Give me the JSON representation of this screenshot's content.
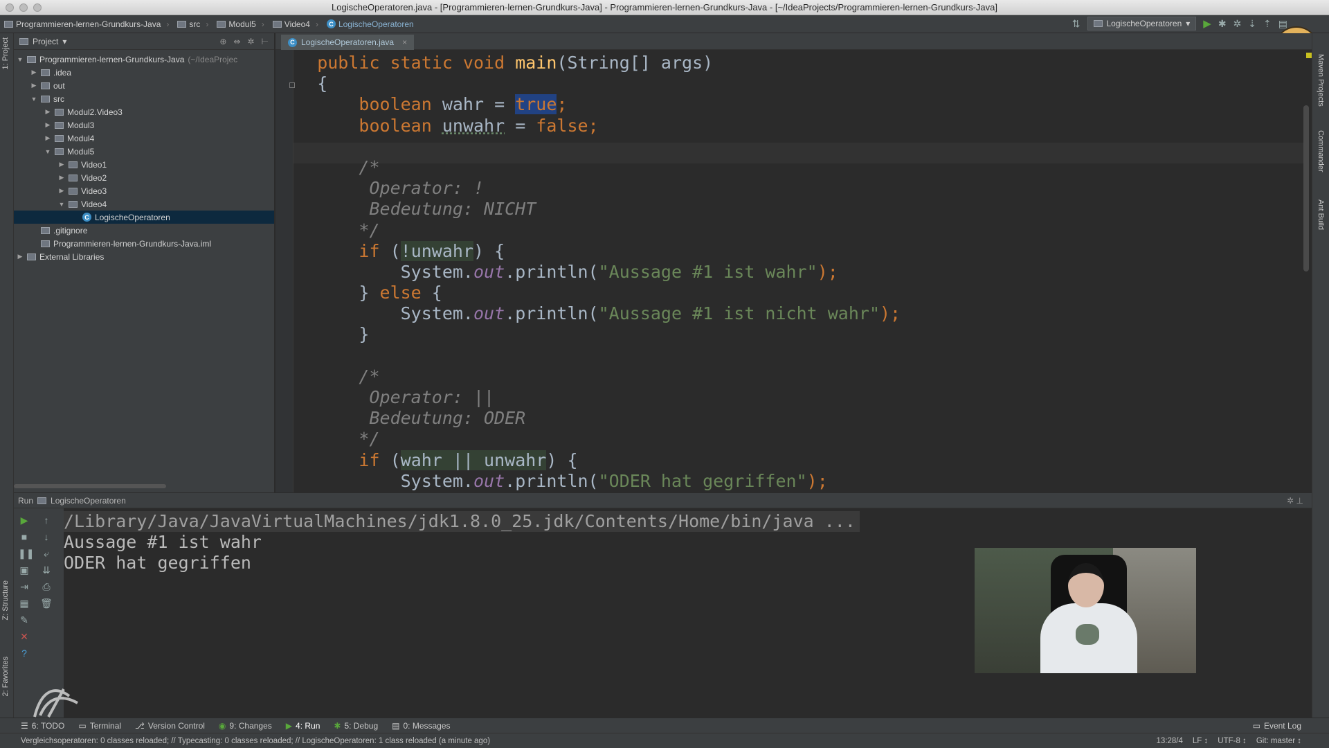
{
  "window": {
    "title": "LogischeOperatoren.java - [Programmieren-lernen-Grundkurs-Java] - Programmieren-lernen-Grundkurs-Java - [~/IdeaProjects/Programmieren-lernen-Grundkurs-Java]"
  },
  "breadcrumbs": [
    "Programmieren-lernen-Grundkurs-Java",
    "src",
    "Modul5",
    "Video4",
    "LogischeOperatoren"
  ],
  "toolbar": {
    "run_config": "LogischeOperatoren"
  },
  "left_strip": {
    "project_tab": "1: Project",
    "structure_tab": "Z: Structure",
    "favorites_tab": "2: Favorites"
  },
  "right_strip": {
    "maven": "Maven Projects",
    "commander": "Commander",
    "ant": "Ant Build"
  },
  "project_panel": {
    "header": "Project",
    "tree": [
      {
        "label": "Programmieren-lernen-Grundkurs-Java",
        "hint": "(~/IdeaProjec",
        "depth": 0,
        "expanded": true,
        "icon": "module-icon"
      },
      {
        "label": ".idea",
        "depth": 1,
        "expanded": false,
        "icon": "folder-icon"
      },
      {
        "label": "out",
        "depth": 1,
        "expanded": false,
        "icon": "folder-icon"
      },
      {
        "label": "src",
        "depth": 1,
        "expanded": true,
        "icon": "folder-icon"
      },
      {
        "label": "Modul2.Video3",
        "depth": 2,
        "expanded": false,
        "icon": "package-icon"
      },
      {
        "label": "Modul3",
        "depth": 2,
        "expanded": false,
        "icon": "package-icon"
      },
      {
        "label": "Modul4",
        "depth": 2,
        "expanded": false,
        "icon": "package-icon"
      },
      {
        "label": "Modul5",
        "depth": 2,
        "expanded": true,
        "icon": "package-icon"
      },
      {
        "label": "Video1",
        "depth": 3,
        "expanded": false,
        "icon": "package-icon"
      },
      {
        "label": "Video2",
        "depth": 3,
        "expanded": false,
        "icon": "package-icon"
      },
      {
        "label": "Video3",
        "depth": 3,
        "expanded": false,
        "icon": "package-icon"
      },
      {
        "label": "Video4",
        "depth": 3,
        "expanded": true,
        "icon": "package-icon"
      },
      {
        "label": "LogischeOperatoren",
        "depth": 4,
        "selected": true,
        "icon": "java-class-icon"
      },
      {
        "label": ".gitignore",
        "depth": 1,
        "icon": "file-icon"
      },
      {
        "label": "Programmieren-lernen-Grundkurs-Java.iml",
        "depth": 1,
        "icon": "iml-file-icon"
      },
      {
        "label": "External Libraries",
        "depth": 0,
        "expanded": false,
        "icon": "library-icon"
      }
    ]
  },
  "editor": {
    "tab_label": "LogischeOperatoren.java",
    "code_lines": [
      [
        [
          "    public static void ",
          "kw"
        ],
        [
          "main",
          "fn"
        ],
        [
          "(String[] args)",
          ""
        ]
      ],
      [
        [
          "    {",
          ""
        ]
      ],
      [
        [
          "        boolean ",
          "kw"
        ],
        [
          "wahr",
          ""
        ],
        [
          " = ",
          ""
        ],
        [
          "true",
          "kw hlsel"
        ],
        [
          ";",
          "kw"
        ]
      ],
      [
        [
          "        boolean ",
          "kw"
        ],
        [
          "unwahr",
          "und"
        ],
        [
          " = ",
          ""
        ],
        [
          "false",
          "kw"
        ],
        [
          ";",
          "kw"
        ]
      ],
      [
        [
          "",
          ""
        ]
      ],
      [
        [
          "        /*",
          "cm"
        ]
      ],
      [
        [
          "         Operator: !",
          "cm"
        ]
      ],
      [
        [
          "         Bedeutung: NICHT",
          "cm"
        ]
      ],
      [
        [
          "        */",
          "cm"
        ]
      ],
      [
        [
          "        if ",
          "kw"
        ],
        [
          "(",
          ""
        ],
        [
          "!unwahr",
          "hl"
        ],
        [
          ") {",
          ""
        ]
      ],
      [
        [
          "            System.",
          ""
        ],
        [
          "out",
          "fld"
        ],
        [
          ".println(",
          ""
        ],
        [
          "\"Aussage #1 ist wahr\"",
          "st"
        ],
        [
          ");",
          "kw"
        ]
      ],
      [
        [
          "        } ",
          ""
        ],
        [
          "else",
          "kw"
        ],
        [
          " {",
          ""
        ]
      ],
      [
        [
          "            System.",
          ""
        ],
        [
          "out",
          "fld"
        ],
        [
          ".println(",
          ""
        ],
        [
          "\"Aussage #1 ist nicht wahr\"",
          "st"
        ],
        [
          ");",
          "kw"
        ]
      ],
      [
        [
          "        }",
          ""
        ]
      ],
      [
        [
          "",
          ""
        ]
      ],
      [
        [
          "        /*",
          "cm"
        ]
      ],
      [
        [
          "         Operator: ||",
          "cm"
        ]
      ],
      [
        [
          "         Bedeutung: ODER",
          "cm"
        ]
      ],
      [
        [
          "        */",
          "cm"
        ]
      ],
      [
        [
          "        if ",
          "kw"
        ],
        [
          "(",
          ""
        ],
        [
          "wahr || unwahr",
          "hl"
        ],
        [
          ") {",
          ""
        ]
      ],
      [
        [
          "            System.",
          ""
        ],
        [
          "out",
          "fld"
        ],
        [
          ".println(",
          ""
        ],
        [
          "\"ODER hat gegriffen\"",
          "st"
        ],
        [
          ");",
          "kw"
        ]
      ]
    ]
  },
  "run_panel": {
    "header_label": "Run",
    "config_name": "LogischeOperatoren",
    "output": [
      "/Library/Java/JavaVirtualMachines/jdk1.8.0_25.jdk/Contents/Home/bin/java ...",
      "Aussage #1 ist wahr",
      "ODER hat gegriffen"
    ]
  },
  "tool_windows": [
    {
      "label": "6: TODO",
      "icon": "todo-icon"
    },
    {
      "label": "Terminal",
      "icon": "terminal-icon"
    },
    {
      "label": "Version Control",
      "icon": "vcs-icon"
    },
    {
      "label": "9: Changes",
      "icon": "changes-icon"
    },
    {
      "label": "4: Run",
      "icon": "run-icon",
      "active": true
    },
    {
      "label": "5: Debug",
      "icon": "debug-icon"
    },
    {
      "label": "0: Messages",
      "icon": "messages-icon"
    }
  ],
  "event_log": "Event Log",
  "status": {
    "message": "Vergleichsoperatoren: 0 classes reloaded; // Typecasting: 0 classes reloaded; // LogischeOperatoren: 1 class reloaded (a minute ago)",
    "position": "13:28/4",
    "line_sep": "LF ↕",
    "encoding": "UTF-8 ↕",
    "git": "Git: master ↕"
  },
  "colors": {
    "keyword": "#cc7832",
    "string": "#6a8759",
    "comment": "#808080",
    "method": "#ffc66d",
    "field": "#9876aa",
    "selection": "#214283"
  }
}
